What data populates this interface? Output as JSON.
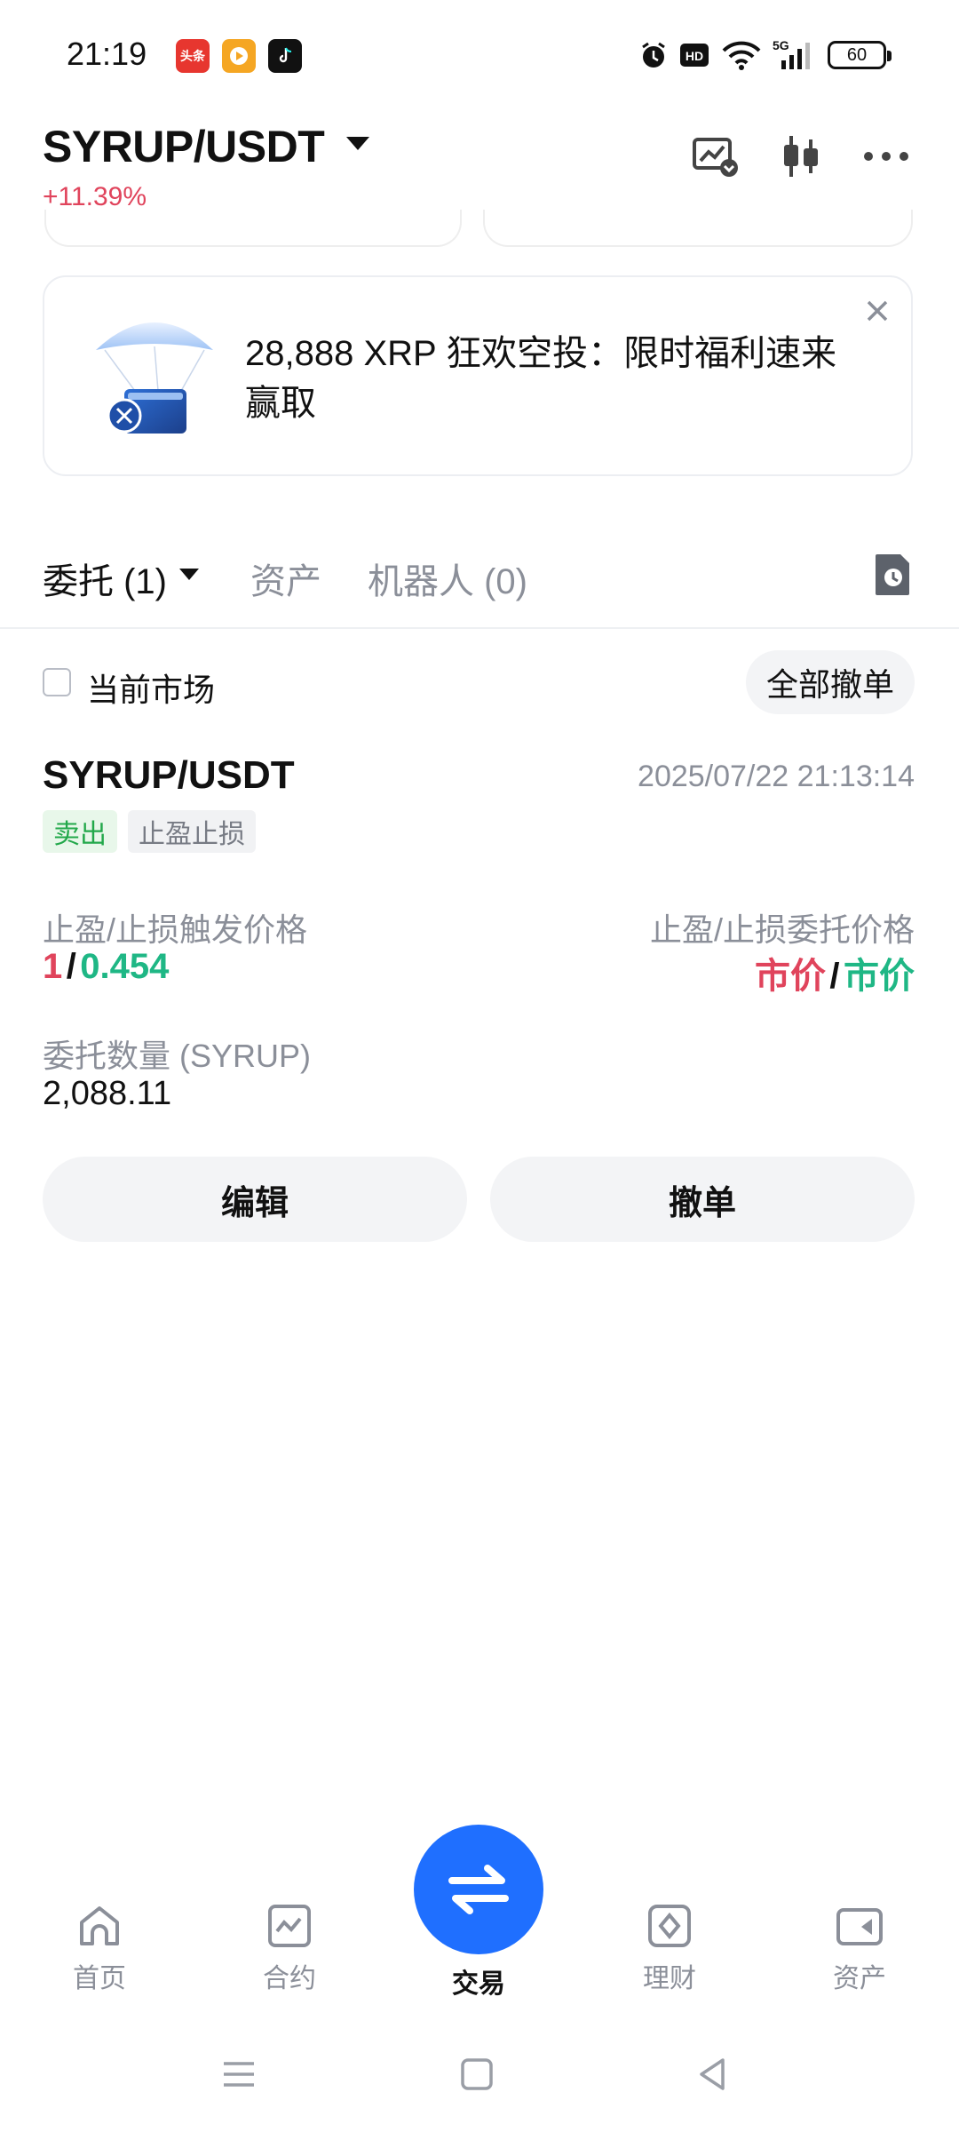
{
  "status_bar": {
    "time": "21:19",
    "apps": [
      {
        "name": "toutiao",
        "text": "头条",
        "color": "#e7362f"
      },
      {
        "name": "video-app",
        "text": "",
        "color": "#f5a623"
      },
      {
        "name": "tiktok",
        "text": "",
        "color": "#111111"
      }
    ],
    "network": "5G",
    "battery": "60"
  },
  "header": {
    "pair": "SYRUP/USDT",
    "change": "+11.39%"
  },
  "promo": {
    "text": "28,888 XRP 狂欢空投：限时福利速来赢取"
  },
  "tabs": [
    {
      "label": "委托 (1)",
      "active": true
    },
    {
      "label": "资产",
      "active": false
    },
    {
      "label": "机器人 (0)",
      "active": false
    }
  ],
  "filter": {
    "checkbox_label": "当前市场",
    "cancel_all": "全部撤单"
  },
  "order": {
    "pair": "SYRUP/USDT",
    "time": "2025/07/22 21:13:14",
    "tags": [
      "卖出",
      "止盈止损"
    ],
    "trigger_label": "止盈/止损触发价格",
    "trigger_tp": "1",
    "trigger_sep": "/",
    "trigger_sl": "0.454",
    "order_price_label": "止盈/止损委托价格",
    "order_tp": "市价",
    "order_sep": "/",
    "order_sl": "市价",
    "amount_label": "委托数量 (SYRUP)",
    "amount": "2,088.11",
    "edit": "编辑",
    "cancel": "撤单"
  },
  "bottom_nav": [
    {
      "label": "首页",
      "icon": "home-icon"
    },
    {
      "label": "合约",
      "icon": "futures-icon"
    },
    {
      "label": "交易",
      "icon": "swap-icon"
    },
    {
      "label": "理财",
      "icon": "earn-icon"
    },
    {
      "label": "资产",
      "icon": "wallet-icon"
    }
  ]
}
